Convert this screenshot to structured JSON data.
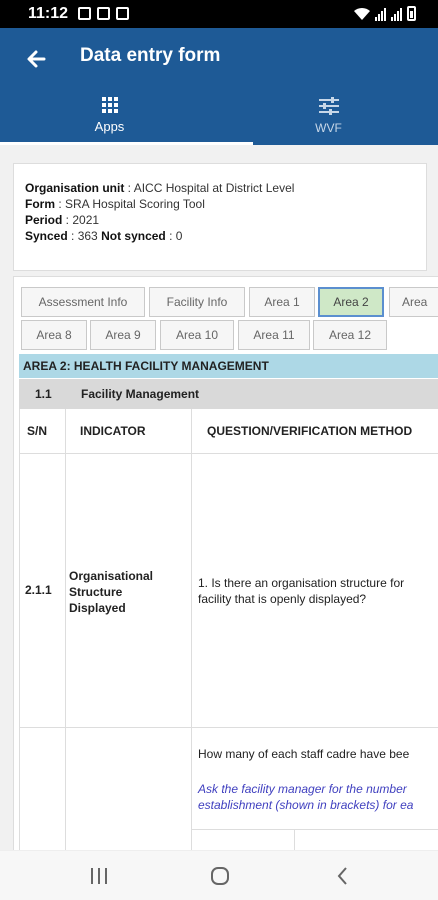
{
  "status_bar": {
    "time": "11:12"
  },
  "app_bar": {
    "title": "Data entry form",
    "tabs": [
      {
        "label": "Apps",
        "icon": "grid-icon",
        "active": true
      },
      {
        "label": "WVF",
        "icon": "sliders-icon",
        "active": false
      }
    ]
  },
  "info": {
    "org_label": "Organisation unit",
    "org_value": "AICC Hospital at District Level",
    "form_label": "Form",
    "form_value": "SRA Hospital Scoring Tool",
    "period_label": "Period",
    "period_value": "2021",
    "synced_label": "Synced",
    "synced_value": "363",
    "not_synced_label": "Not synced",
    "not_synced_value": "0"
  },
  "section_tabs_row1": [
    "Assessment Info",
    "Facility Info",
    "Area 1",
    "Area 2",
    "Area"
  ],
  "section_tabs_row2": [
    "Area 8",
    "Area 9",
    "Area 10",
    "Area 11",
    "Area 12"
  ],
  "active_section": "Area 2",
  "area_banner": "AREA 2: HEALTH FACILITY MANAGEMENT",
  "subsection": {
    "number": "1.1",
    "name": "Facility Management"
  },
  "table": {
    "headers": {
      "sn": "S/N",
      "indicator": "INDICATOR",
      "question": "QUESTION/VERIFICATION METHOD"
    },
    "row1": {
      "sn": "2.1.1",
      "indicator_line1": "Organisational",
      "indicator_line2": "Structure",
      "indicator_line3": "Displayed",
      "question_line1": "1. Is there an organisation structure for",
      "question_line2": "facility that is openly displayed?"
    },
    "row2": {
      "question": "How many of each staff cadre have bee",
      "hint_line1": "Ask the facility manager for the number",
      "hint_line2": "establishment (shown in brackets) for ea"
    }
  },
  "colors": {
    "app_bar": "#1e5a96",
    "area_banner": "#add8e6",
    "active_tab_fill": "#cfe8c7",
    "active_tab_border": "#5b8fcf",
    "hint_text": "#3f3fbf"
  }
}
